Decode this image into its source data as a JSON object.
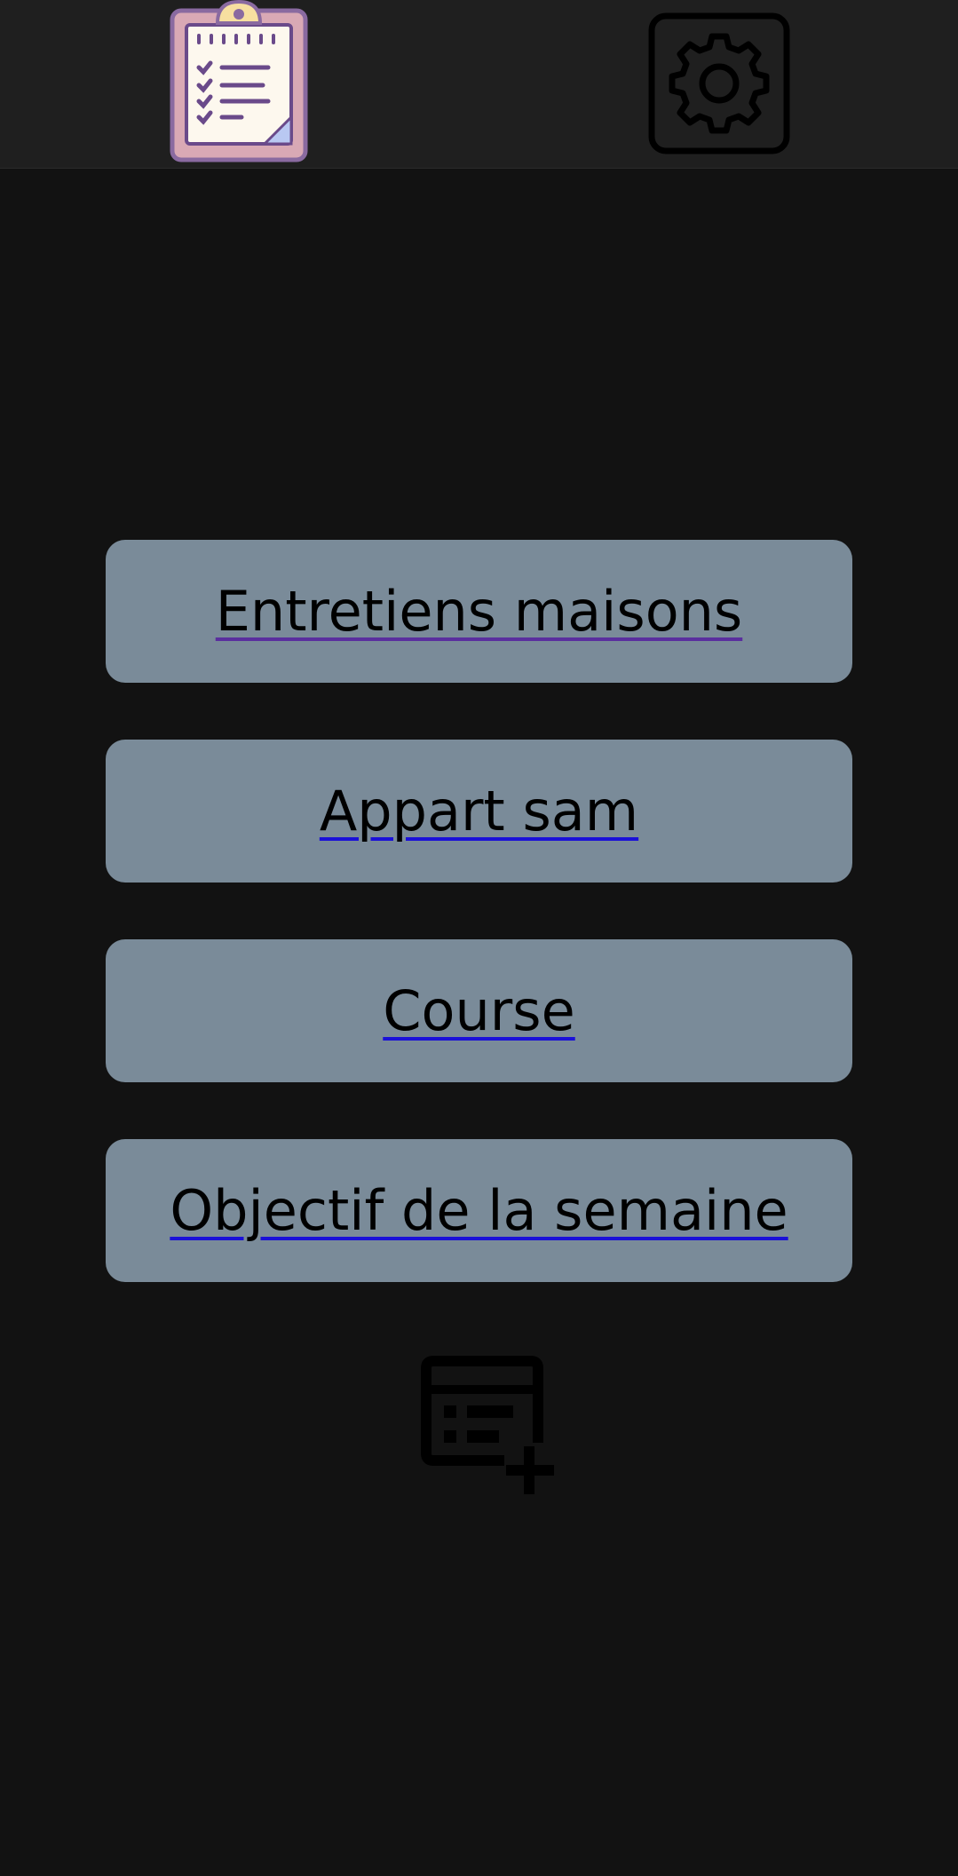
{
  "header": {
    "logo_icon": "clipboard-checklist-icon",
    "settings_icon": "gear-icon"
  },
  "lists": [
    {
      "label": "Entretiens maisons",
      "visited": true
    },
    {
      "label": "Appart sam",
      "visited": false
    },
    {
      "label": "Course",
      "visited": false
    },
    {
      "label": "Objectif de la semaine",
      "visited": false
    }
  ],
  "add_list": {
    "icon": "add-list-icon"
  },
  "colors": {
    "background": "#121212",
    "topbar": "#1f1f1f",
    "button": "#7a8b99",
    "link_underline": "#1a10d8",
    "visited_underline": "#5a2e9e"
  }
}
